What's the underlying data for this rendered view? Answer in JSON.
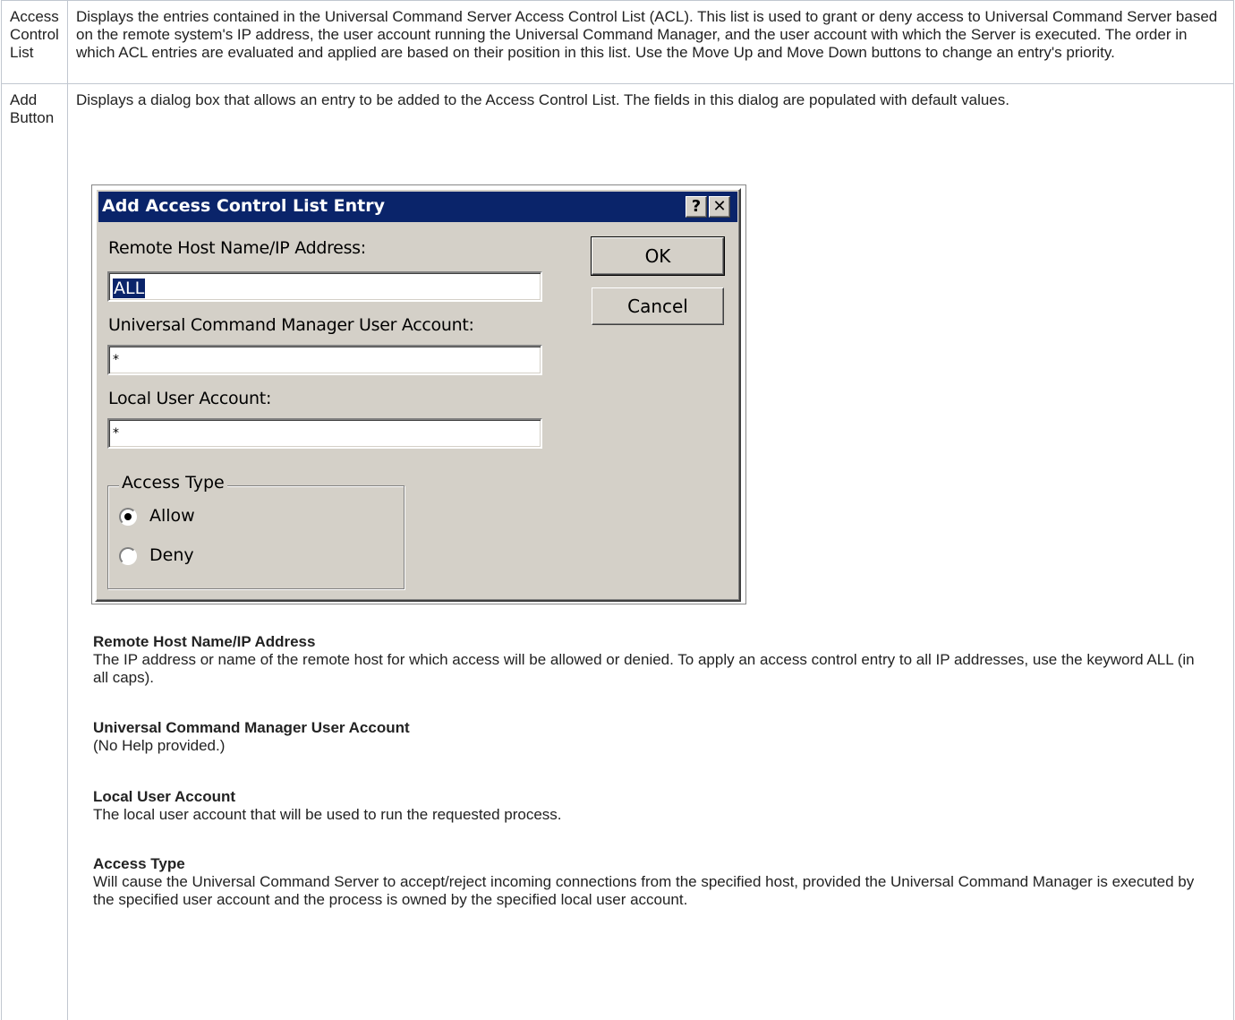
{
  "rows": [
    {
      "label": "Access Control List",
      "description": "Displays the entries contained in the Universal Command Server Access Control List (ACL). This list is used to grant or deny access to Universal Command Server based on the remote system's IP address, the user account running the Universal Command Manager, and the user account with which the Server is executed. The order in which ACL entries are evaluated and applied are based on their position in this list. Use the Move Up and Move Down buttons to change an entry's priority."
    },
    {
      "label": "Add Button",
      "description": "Displays a dialog box that allows an entry to be added to the Access Control List. The fields in this dialog are populated with default values."
    }
  ],
  "dialog": {
    "title": "Add Access Control List Entry",
    "help_glyph": "?",
    "close_glyph": "✕",
    "remote_host_label": "Remote Host Name/IP Address:",
    "remote_host_value": "ALL",
    "manager_user_label": "Universal Command Manager User Account:",
    "manager_user_value": "*",
    "local_user_label": "Local User Account:",
    "local_user_value": "*",
    "access_type_legend": "Access Type",
    "radio_allow": "Allow",
    "radio_deny": "Deny",
    "selected_access_type": "Allow",
    "ok_label": "OK",
    "cancel_label": "Cancel"
  },
  "field_help": [
    {
      "heading": "Remote Host Name/IP Address",
      "text": "The IP address or name of the remote host for which access will be allowed or denied. To apply an access control entry to all IP addresses, use the keyword ALL (in all caps)."
    },
    {
      "heading": "Universal Command Manager User Account",
      "text": "(No Help provided.)"
    },
    {
      "heading": "Local User Account",
      "text": "The local user account that will be used to run the requested process."
    },
    {
      "heading": "Access Type",
      "text": "Will cause the Universal Command Server to accept/reject incoming connections from the specified host, provided the Universal Command Manager is executed by the specified user account and the process is owned by the specified local user account."
    }
  ]
}
